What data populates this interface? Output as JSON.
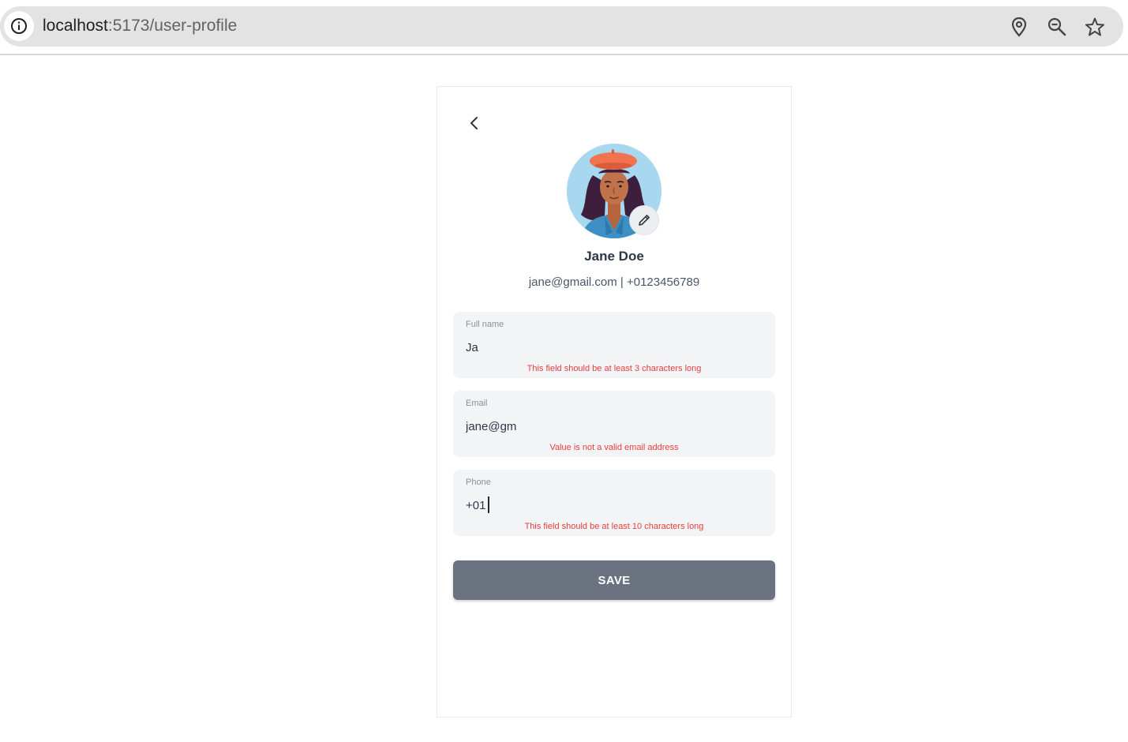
{
  "browser": {
    "url_host": "localhost",
    "url_path": ":5173/user-profile",
    "icons": [
      "info-icon",
      "location-icon",
      "zoom-out-icon",
      "bookmark-star-icon"
    ]
  },
  "profile": {
    "name": "Jane Doe",
    "contact": "jane@gmail.com | +0123456789",
    "avatar": "woman-with-orange-beret-avatar"
  },
  "form": {
    "full_name": {
      "label": "Full name",
      "value": "Ja",
      "error": "This field should be at least 3 characters long"
    },
    "email": {
      "label": "Email",
      "value": "jane@gm",
      "error": "Value is not a valid email address"
    },
    "phone": {
      "label": "Phone",
      "value": "+01",
      "error": "This field should be at least 10 characters long"
    },
    "save_label": "SAVE"
  },
  "colors": {
    "error": "#e53e3e",
    "save_button": "#6b7280",
    "field_background": "#f3f4f6",
    "beret": "#f2734f"
  }
}
